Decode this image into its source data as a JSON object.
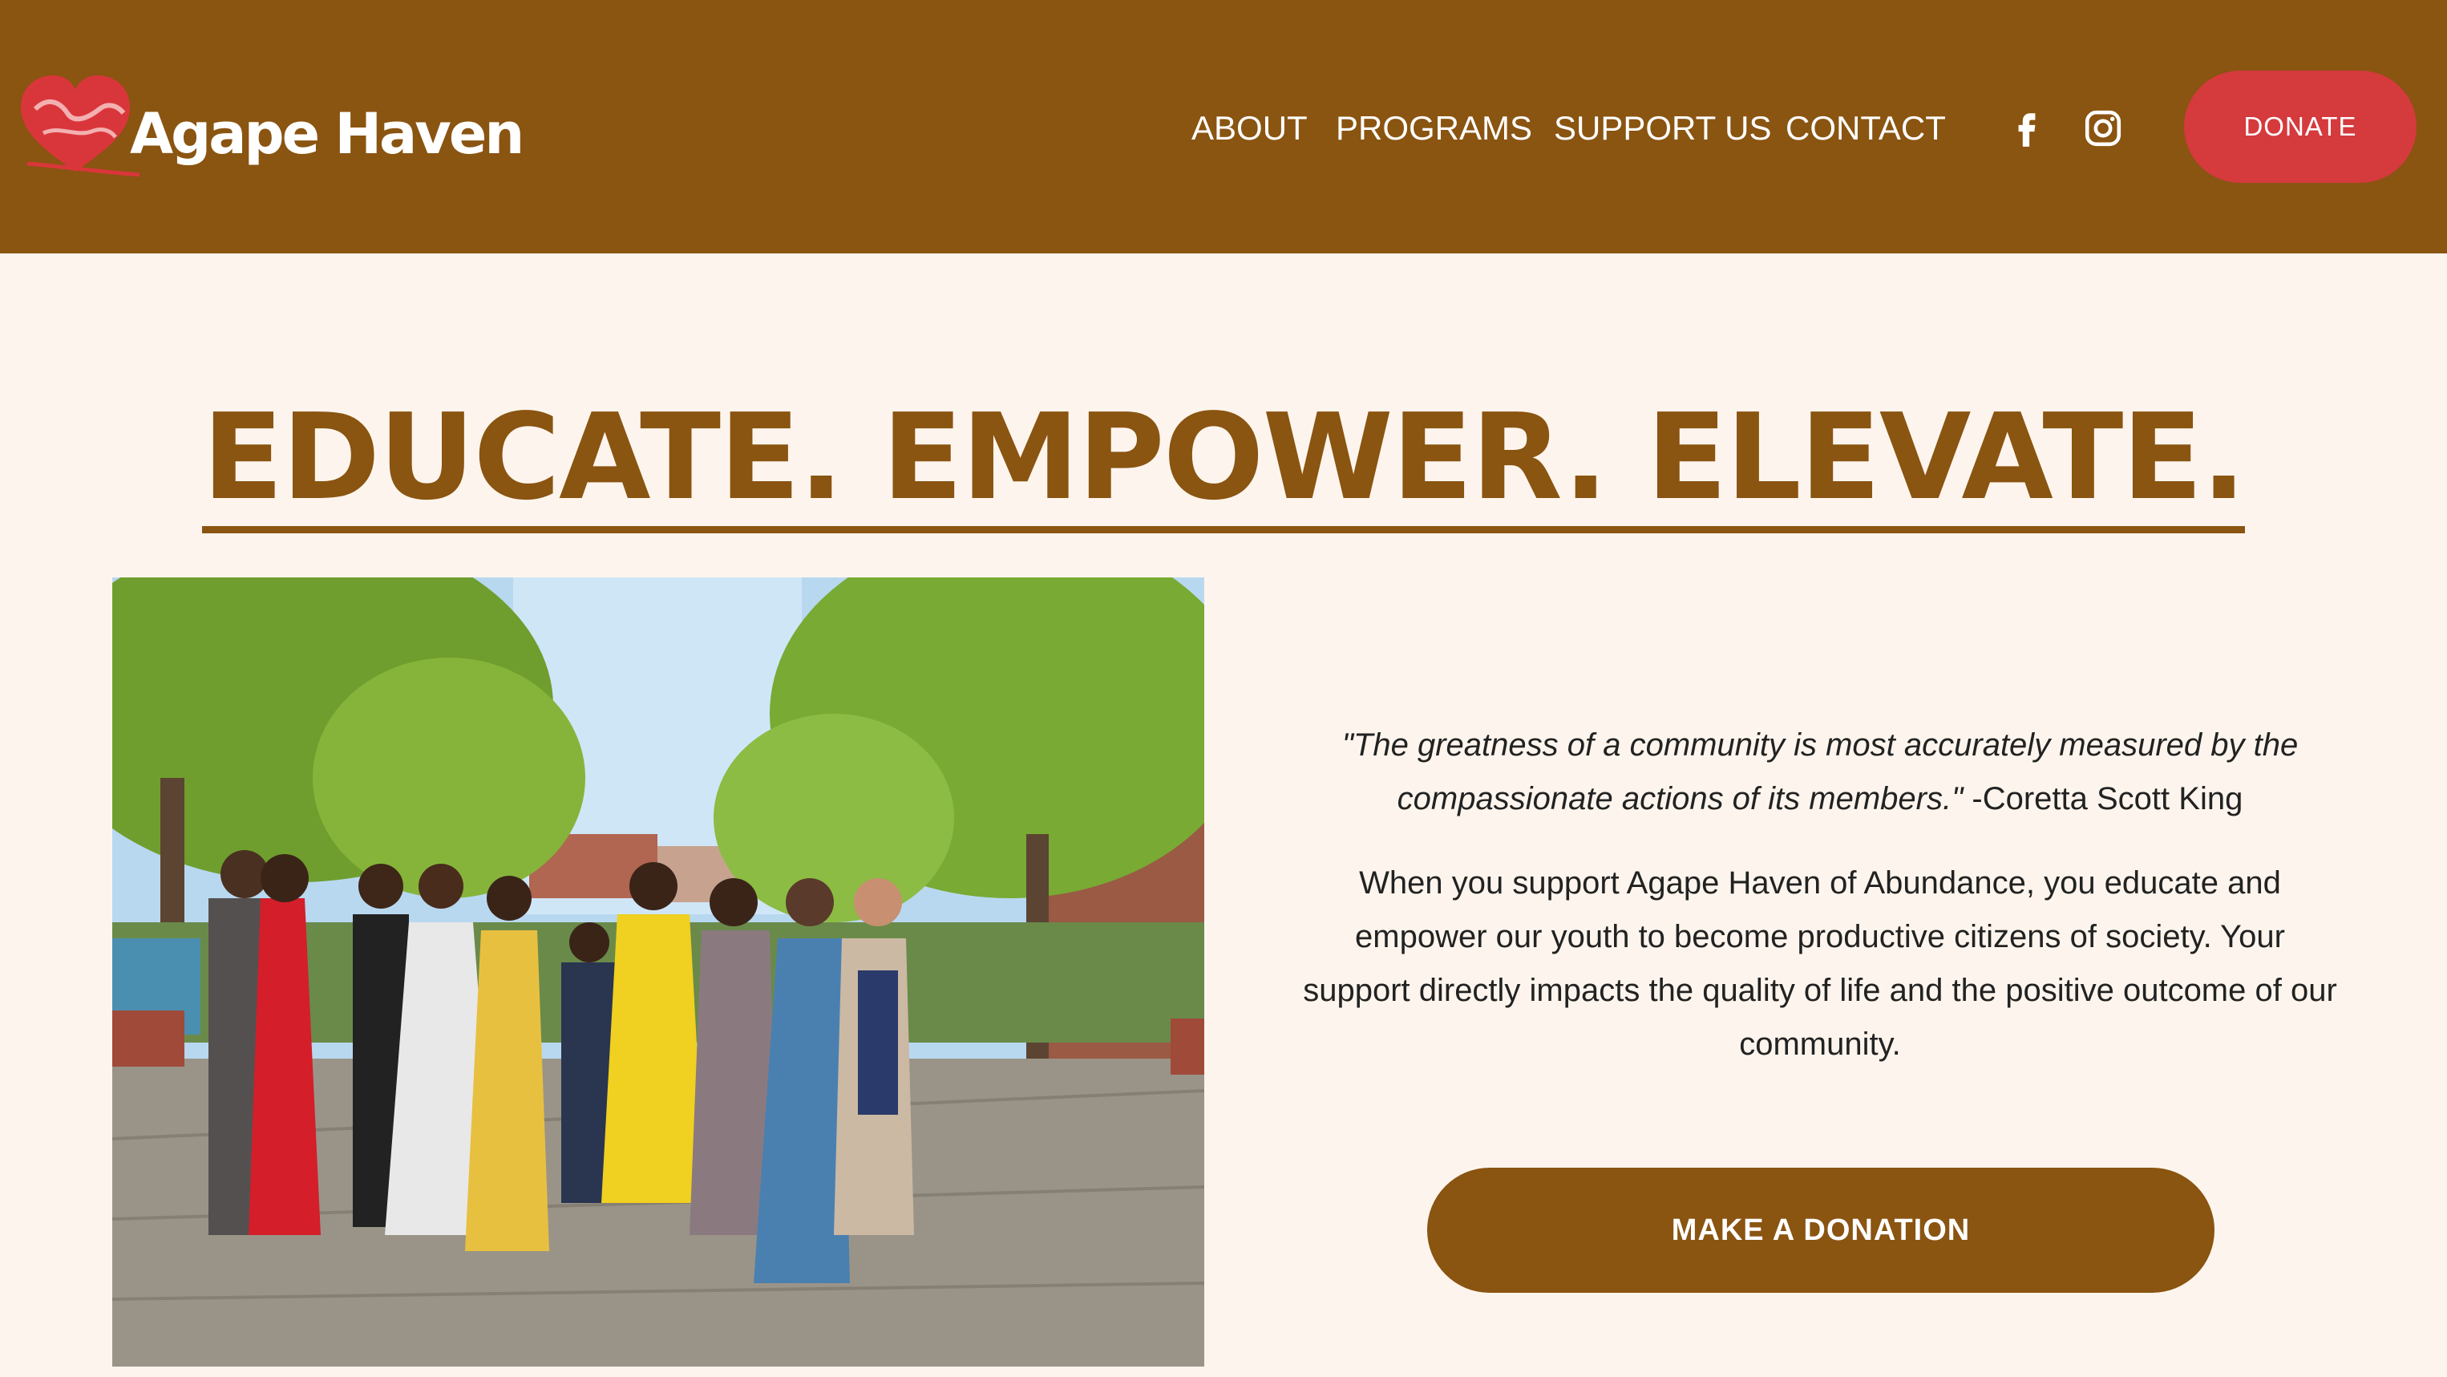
{
  "header": {
    "logo_text": "Agape Haven",
    "nav": [
      "ABOUT",
      "PROGRAMS",
      "SUPPORT US",
      "CONTACT"
    ],
    "social_icons": [
      "facebook-icon",
      "instagram-icon"
    ],
    "donate_label": "DONATE"
  },
  "hero": {
    "headline": "EDUCATE. EMPOWER. ELEVATE.",
    "quote": "\"The greatness of a community is most accurately measured by the compassionate actions of its members.\"",
    "quote_author": " -Coretta Scott King",
    "body": "When you support Agape Haven of Abundance, you educate and empower our youth to become productive citizens of society. Your support directly impacts the quality of life and the positive outcome of our community.",
    "cta_label": "MAKE A DONATION"
  },
  "colors": {
    "brand_brown": "#8a5411",
    "donate_red": "#d53a3d",
    "page_background": "#fdf5ed"
  }
}
